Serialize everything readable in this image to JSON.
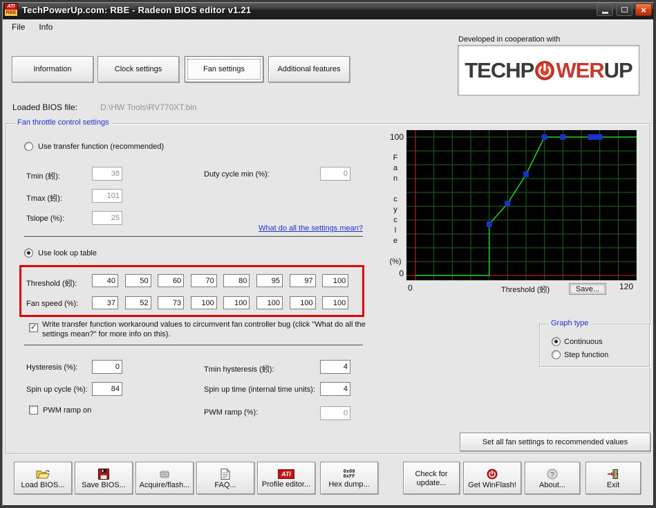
{
  "window": {
    "title": "TechPowerUp.com: RBE - Radeon BIOS editor v1.21",
    "icon_top": "ATI",
    "icon_bottom": "RBE"
  },
  "menu": {
    "items": [
      {
        "label": "File"
      },
      {
        "label": "Info"
      }
    ]
  },
  "tabs": [
    {
      "label": "Information",
      "active": false
    },
    {
      "label": "Clock settings",
      "active": false
    },
    {
      "label": "Fan settings",
      "active": true
    },
    {
      "label": "Additional features",
      "active": false
    }
  ],
  "logo_panel": {
    "caption": "Developed in cooperation with",
    "logo_part1": "TECHP",
    "logo_part2": "WER",
    "logo_part3": "UP"
  },
  "bios": {
    "label": "Loaded BIOS file:",
    "value": "D:\\HW Tools\\RV770XT.bin"
  },
  "fan_group": {
    "title": "Fan throttle control settings",
    "transfer_radio": {
      "label": "Use transfer function (recommended)",
      "selected": false
    },
    "tmin_label": "Tmin (蚓):",
    "tmin_value": "38",
    "tmax_label": "Tmax (蚓):",
    "tmax_value": "101",
    "tslope_label": "Tslope (%):",
    "tslope_value": "25",
    "duty_label": "Duty cycle min (%):",
    "duty_value": "0",
    "link": "What do all the settings mean?",
    "lookup_radio": {
      "label": "Use look up table",
      "selected": true
    },
    "table": {
      "threshold_label": "Threshold (蚓):",
      "fanspeed_label": "Fan speed (%):",
      "thresholds": [
        "40",
        "50",
        "60",
        "70",
        "80",
        "95",
        "97",
        "100"
      ],
      "fan_speeds": [
        "37",
        "52",
        "73",
        "100",
        "100",
        "100",
        "100",
        "100"
      ]
    },
    "workaround_checkbox": {
      "checked": true,
      "label": "Write transfer function workaround values to circumvent fan controller bug (click \"What do all the settings mean?\" for more info on this)."
    },
    "hysteresis_label": "Hysteresis (%):",
    "hysteresis_value": "0",
    "tmin_hyst_label": "Tmin hysteresis (蚓):",
    "tmin_hyst_value": "4",
    "spinup_cycle_label": "Spin up cycle (%):",
    "spinup_cycle_value": "84",
    "spinup_time_label": "Spin up time (internal time units):",
    "spinup_time_value": "4",
    "pwm_ramp_on_label": "PWM ramp on",
    "pwm_ramp_on_checked": false,
    "pwm_ramp_label": "PWM ramp (%):",
    "pwm_ramp_value": "0"
  },
  "graph": {
    "y_top_label": "100",
    "y_bottom_label": "0",
    "y_axis_letters": [
      "F",
      "a",
      "n",
      "",
      "c",
      "y",
      "c",
      "l",
      "e",
      "",
      "(%)"
    ],
    "x_left_label": "0",
    "x_right_label": "120",
    "x_axis_title": "Threshold (蚓)",
    "save_button": "Save...",
    "colors": {
      "grid": "#1e651e",
      "curve": "#21d421",
      "marker": "#1832cc",
      "axis": "#e02020",
      "bg": "#000000"
    }
  },
  "chart_data": {
    "type": "line",
    "x": [
      40,
      50,
      60,
      70,
      80,
      95,
      97,
      100
    ],
    "y": [
      37,
      52,
      73,
      100,
      100,
      100,
      100,
      100
    ],
    "xlabel": "Threshold (蚓)",
    "ylabel": "Fan cycle (%)",
    "xlim": [
      0,
      120
    ],
    "ylim": [
      0,
      105
    ],
    "grid": true,
    "note": "green step/line curve starts at (0,0), runs flat to x=40, rises through points, flat at 100% to x=120; blue square markers at each lookup point"
  },
  "graph_type": {
    "title": "Graph type",
    "options": [
      {
        "label": "Continuous",
        "selected": true
      },
      {
        "label": "Step function",
        "selected": false
      }
    ]
  },
  "set_all_button": "Set all fan settings to recommended values",
  "bottom_buttons": [
    {
      "label": "Load BIOS...",
      "icon": "folder-open-icon"
    },
    {
      "label": "Save BIOS...",
      "icon": "floppy-disk-icon"
    },
    {
      "label": "Acquire/flash...",
      "icon": "chip-icon"
    },
    {
      "label": "FAQ...",
      "icon": "document-icon"
    },
    {
      "label": "Profile editor...",
      "icon": "ati-logo-icon"
    },
    {
      "label": "Hex dump...",
      "icon": "hex-icon",
      "icon_text": "0x00\n0xFF"
    },
    {
      "label": "Check for update...",
      "icon": "none"
    },
    {
      "label": "Get WinFlash!",
      "icon": "power-icon"
    },
    {
      "label": "About...",
      "icon": "question-icon"
    },
    {
      "label": "Exit",
      "icon": "door-exit-icon"
    }
  ]
}
